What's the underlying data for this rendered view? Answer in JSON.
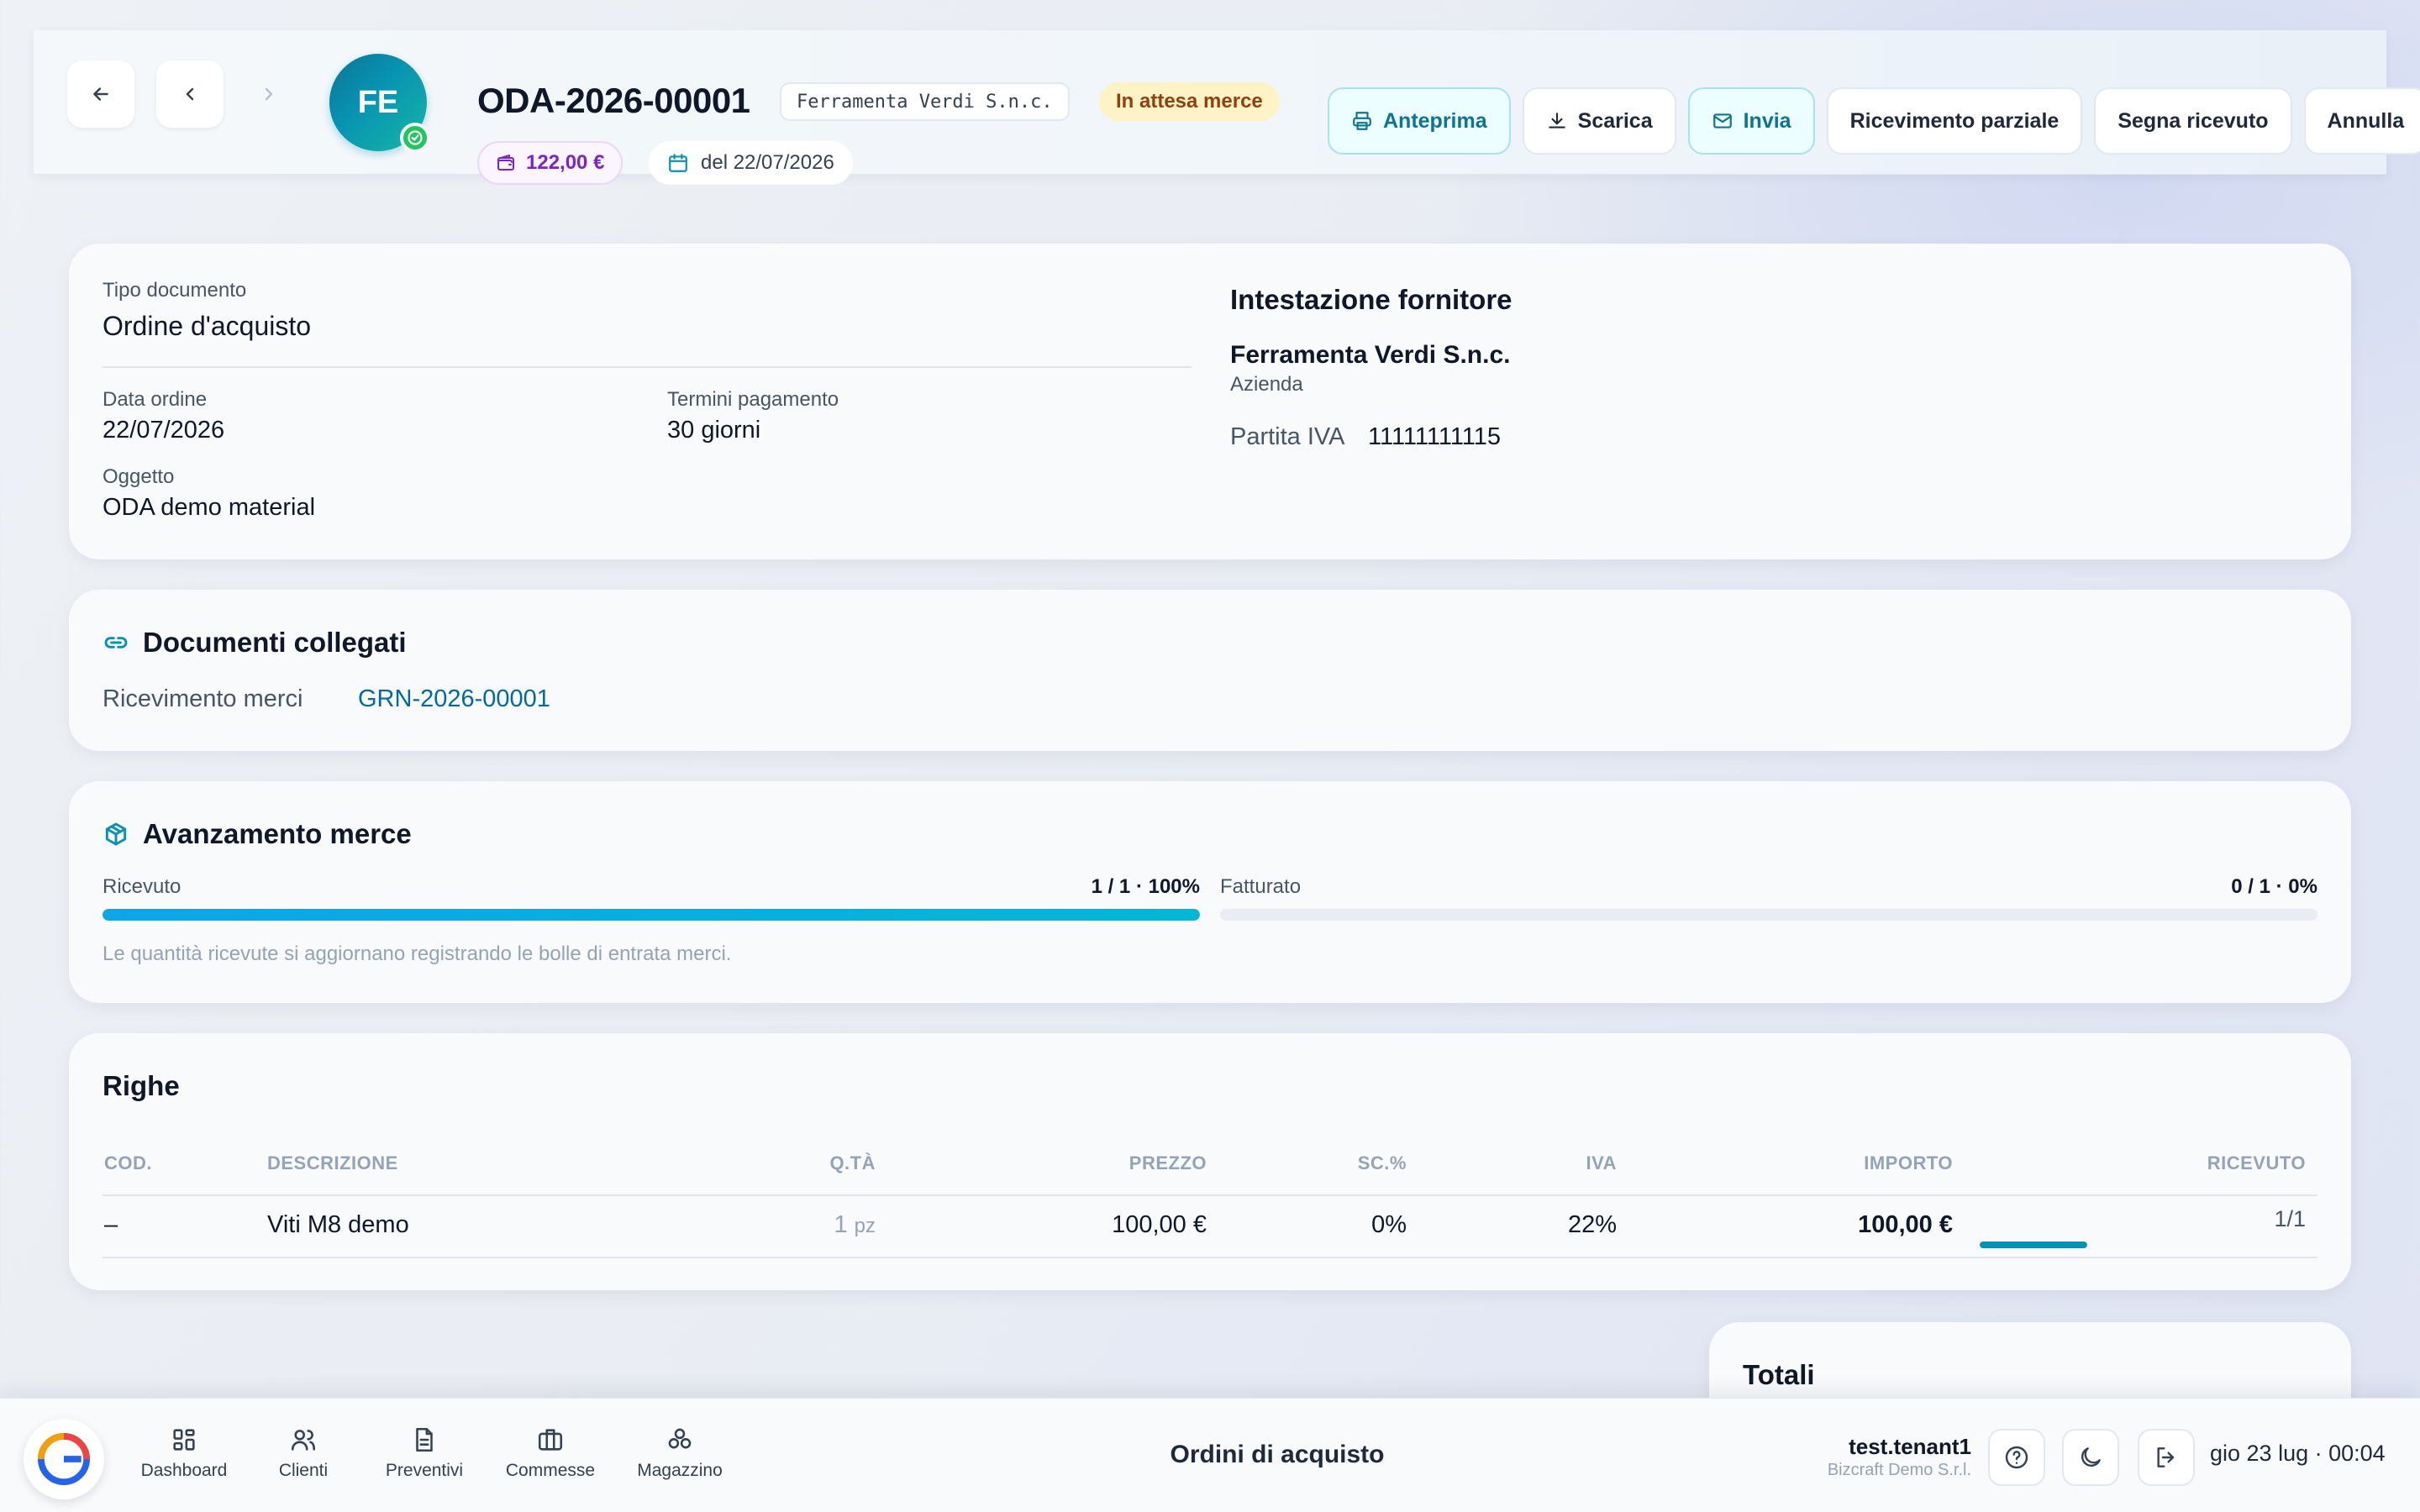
{
  "header": {
    "avatar_initials": "FE",
    "doc_number": "ODA-2026-00001",
    "supplier_chip": "Ferramenta Verdi S.n.c.",
    "status": "In attesa merce",
    "amount": "122,00 €",
    "date": "del 22/07/2026",
    "actions": {
      "preview": "Anteprima",
      "download": "Scarica",
      "send": "Invia",
      "partial_receipt": "Ricevimento parziale",
      "mark_received": "Segna ricevuto",
      "cancel": "Annulla"
    }
  },
  "info": {
    "doc_type_label": "Tipo documento",
    "doc_type_value": "Ordine d'acquisto",
    "order_date_label": "Data ordine",
    "order_date_value": "22/07/2026",
    "payment_terms_label": "Termini pagamento",
    "payment_terms_value": "30 giorni",
    "subject_label": "Oggetto",
    "subject_value": "ODA demo material",
    "supplier_heading": "Intestazione fornitore",
    "supplier_name": "Ferramenta Verdi S.n.c.",
    "supplier_type": "Azienda",
    "vat_label": "Partita IVA",
    "vat_value": "11111111115"
  },
  "linked_docs": {
    "title": "Documenti collegati",
    "goods_receipt_label": "Ricevimento merci",
    "goods_receipt_link": "GRN-2026-00001"
  },
  "progress": {
    "title": "Avanzamento merce",
    "received_label": "Ricevuto",
    "received_value": "1 / 1 · 100%",
    "received_fraction": 1.0,
    "invoiced_label": "Fatturato",
    "invoiced_value": "0 / 1 · 0%",
    "invoiced_fraction": 0.0,
    "note": "Le quantità ricevute si aggiornano registrando le bolle di entrata merci."
  },
  "lines": {
    "title": "Righe",
    "columns": [
      "COD.",
      "DESCRIZIONE",
      "Q.TÀ",
      "PREZZO",
      "SC.%",
      "IVA",
      "IMPORTO",
      "RICEVUTO"
    ],
    "rows": [
      {
        "code": "–",
        "description": "Viti M8 demo",
        "qty": "1",
        "unit": "pz",
        "price": "100,00 €",
        "discount": "0%",
        "vat": "22%",
        "amount": "100,00 €",
        "received": "1/1",
        "received_fraction": 1.0
      }
    ]
  },
  "totals": {
    "title": "Totali"
  },
  "bottombar": {
    "nav": [
      "Dashboard",
      "Clienti",
      "Preventivi",
      "Commesse",
      "Magazzino"
    ],
    "page_title": "Ordini di acquisto",
    "user": "test.tenant1",
    "company": "Bizcraft Demo S.r.l.",
    "datetime": "gio 23 lug · 00:04"
  },
  "colors": {
    "accent": "#0891b2",
    "status_bg": "#fef3c7",
    "amount": "#7e22ce",
    "link": "#0369a1"
  }
}
